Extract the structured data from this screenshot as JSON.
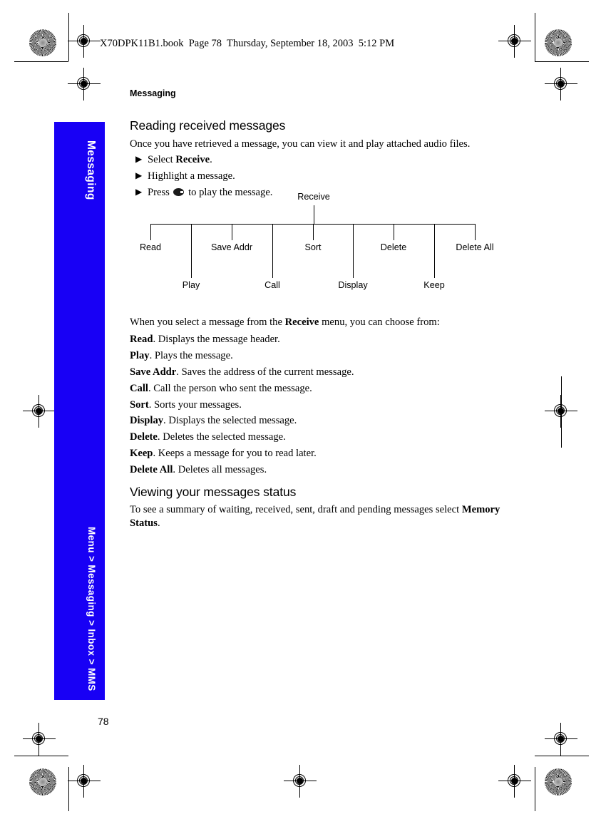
{
  "page": {
    "file_header": "X70DPK11B1.book  Page 78  Thursday, September 18, 2003  5:12 PM",
    "number": "78",
    "accent_color": "#1800f5"
  },
  "sidebar": {
    "top_tab_label": "Messaging",
    "breadcrumb_label": "Menu > Messaging > Inbox > MMS"
  },
  "content": {
    "chapter": "Messaging",
    "section1_heading": "Reading received messages",
    "section1_intro": "Once you have retrieved a message, you can view it and play attached audio files.",
    "steps": [
      {
        "prefix": "Select ",
        "bold": "Receive",
        "suffix": ".",
        "icon": ""
      },
      {
        "prefix": "Highlight a message.",
        "bold": "",
        "suffix": "",
        "icon": ""
      },
      {
        "prefix": "Press ",
        "bold": "",
        "suffix": " to play the message.",
        "icon": "soft-key-glyph"
      }
    ],
    "lead_in_prefix": "When you select a message from the ",
    "lead_in_bold": "Receive",
    "lead_in_suffix": " menu, you can choose from:",
    "definitions": [
      {
        "term": "Read",
        "desc": ". Displays the message header."
      },
      {
        "term": "Play",
        "desc": ". Plays the message."
      },
      {
        "term": "Save Addr",
        "desc": ". Saves the address of the current message."
      },
      {
        "term": "Call",
        "desc": ". Call the person who sent the message."
      },
      {
        "term": "Sort",
        "desc": ". Sorts your messages."
      },
      {
        "term": "Display",
        "desc": ". Displays the selected message."
      },
      {
        "term": "Delete",
        "desc": ". Deletes the selected message."
      },
      {
        "term": "Keep",
        "desc": ". Keeps a message for you to read later."
      },
      {
        "term": "Delete All",
        "desc": ". Deletes all messages."
      }
    ],
    "section2_heading": "Viewing your messages status",
    "section2_body_prefix": "To see a summary of waiting, received, sent, draft and pending messages select ",
    "section2_body_bold": "Memory Status",
    "section2_body_suffix": "."
  },
  "menu_tree": {
    "root": "Receive",
    "branches_above": [
      "Read",
      "Save Addr",
      "Sort",
      "Delete",
      "Delete All"
    ],
    "branches_below": [
      "Play",
      "Call",
      "Display",
      "Keep"
    ]
  }
}
